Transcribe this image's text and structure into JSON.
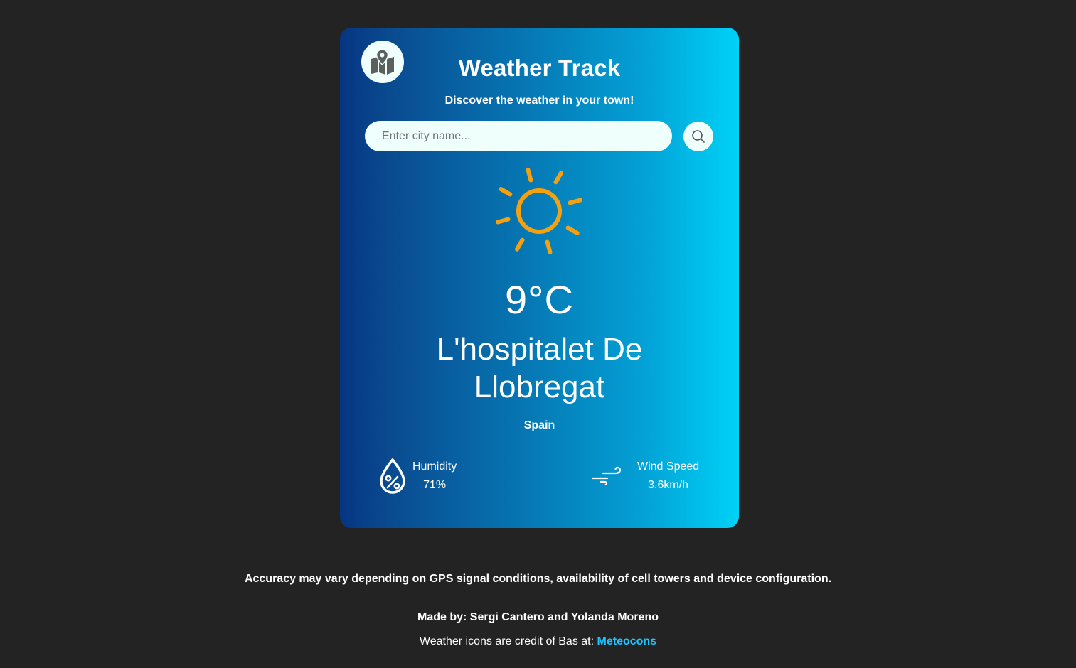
{
  "header": {
    "title": "Weather Track",
    "subtitle": "Discover the weather in your town!"
  },
  "search": {
    "placeholder": "Enter city name...",
    "value": ""
  },
  "weather": {
    "icon": "sun-icon",
    "temperature": "9°C",
    "city_line1": "L'hospitalet De",
    "city_line2": "Llobregat",
    "country": "Spain"
  },
  "stats": {
    "humidity_label": "Humidity",
    "humidity_value": "71%",
    "wind_label": "Wind Speed",
    "wind_value": "3.6km/h"
  },
  "footer": {
    "note": "Accuracy may vary depending on GPS signal conditions, availability of cell towers and device configuration.",
    "made_by": "Made by: Sergi Cantero and Yolanda Moreno",
    "credit_text": "Weather icons are credit of Bas at: ",
    "credit_link": "Meteocons"
  },
  "colors": {
    "page_bg": "#232323",
    "card_gradient_start": "#063582",
    "card_gradient_end": "#00d2f7",
    "sun": "#f5a00f",
    "link": "#1ec3ff",
    "input_bg": "#effffb"
  }
}
